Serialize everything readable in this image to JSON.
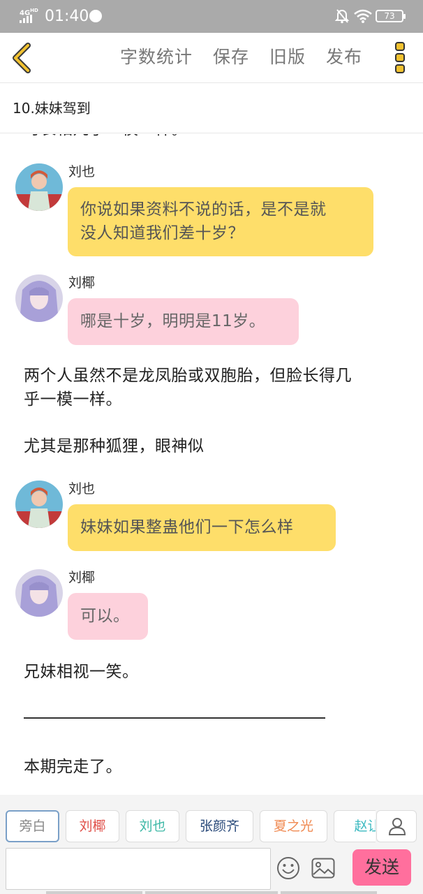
{
  "status_bar": {
    "network": "4G",
    "hd": "HD",
    "time": "01:40",
    "battery": "73"
  },
  "toolbar": {
    "actions": [
      "字数统计",
      "保存",
      "旧版",
      "发布"
    ]
  },
  "chapter": {
    "title": "10.妹妹驾到"
  },
  "content": {
    "cutoff_line": "时长相几乎一模一样。",
    "messages": [
      {
        "type": "bubble",
        "speaker": "刘也",
        "color": "yellow",
        "lines": [
          "你说如果资料不说的话，是不是就",
          "没人知道我们差十岁？"
        ]
      },
      {
        "type": "bubble",
        "speaker": "刘椰",
        "color": "pink",
        "lines": [
          "哪是十岁，明明是11岁。"
        ]
      },
      {
        "type": "narration",
        "lines": [
          "两个人虽然不是龙凤胎或双胞胎，但脸长得几",
          "乎一模一样。"
        ]
      },
      {
        "type": "narration",
        "lines": [
          "尤其是那种狐狸，眼神似"
        ]
      },
      {
        "type": "bubble",
        "speaker": "刘也",
        "color": "yellow",
        "lines": [
          "妹妹如果整蛊他们一下怎么样"
        ]
      },
      {
        "type": "bubble",
        "speaker": "刘椰",
        "color": "pink",
        "lines": [
          "可以。"
        ]
      },
      {
        "type": "narration",
        "lines": [
          "兄妹相视一笑。"
        ]
      },
      {
        "type": "narration",
        "lines": [
          "本期完走了。"
        ]
      }
    ]
  },
  "roles": [
    {
      "name": "旁白",
      "color": "#888888",
      "active": true
    },
    {
      "name": "刘椰",
      "color": "#e0504a",
      "active": false
    },
    {
      "name": "刘也",
      "color": "#3db8a6",
      "active": false
    },
    {
      "name": "张颜齐",
      "color": "#2a4a7a",
      "active": false
    },
    {
      "name": "夏之光",
      "color": "#f08a52",
      "active": false
    },
    {
      "name": "赵让",
      "color": "#3ab9c0",
      "active": false
    }
  ],
  "composer": {
    "input_value": "",
    "input_placeholder": "",
    "send_label": "发送"
  },
  "colors": {
    "accent_send": "#ff6f9d",
    "bubble_yellow": "#fede6a",
    "bubble_pink": "#fdd1dc",
    "status_bar": "#aaaaaa"
  },
  "icons": [
    "back-arrow-icon",
    "more-dots-icon",
    "person-icon",
    "emoji-icon",
    "image-icon",
    "mute-bell-icon",
    "wifi-icon",
    "battery-icon"
  ]
}
